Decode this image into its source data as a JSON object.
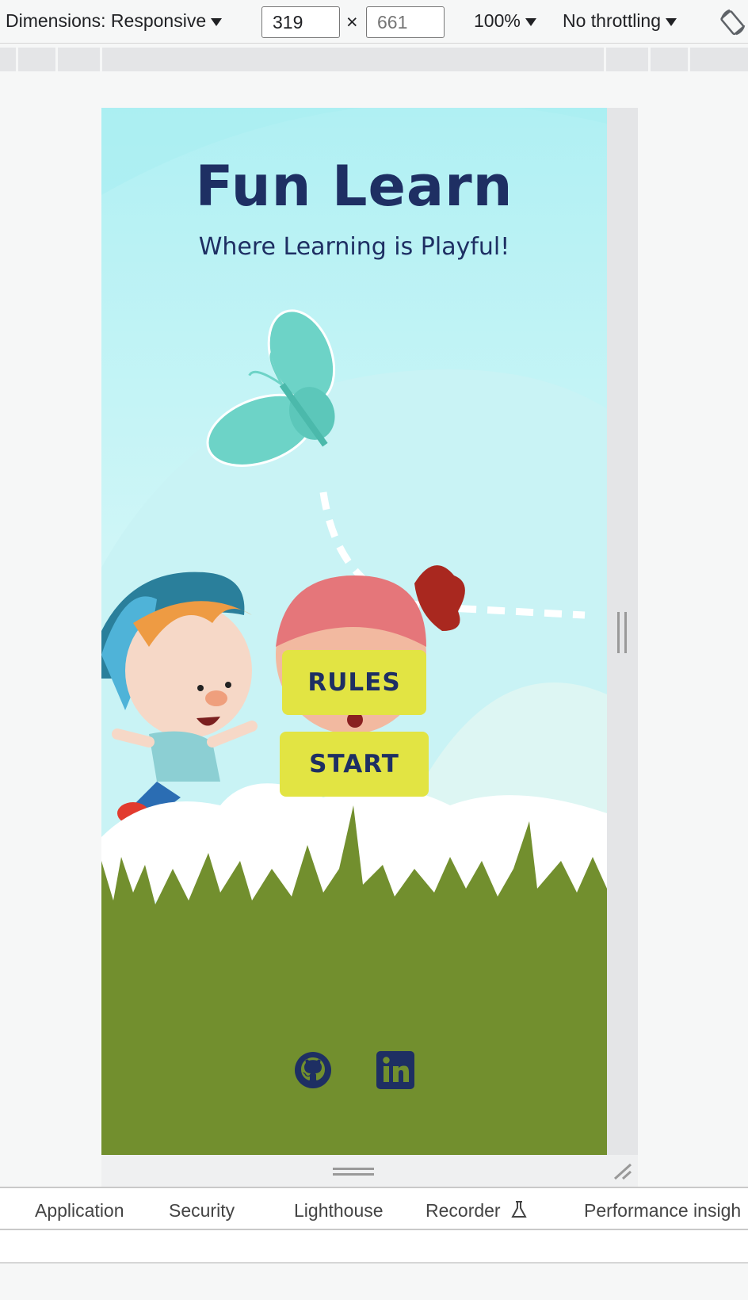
{
  "devtools_toolbar": {
    "dimensions_label": "Dimensions: Responsive",
    "width_value": "319",
    "times_symbol": "×",
    "height_placeholder": "661",
    "zoom_label": "100%",
    "throttling_label": "No throttling"
  },
  "page": {
    "title": "Fun Learn",
    "subtitle": "Where Learning is Playful!",
    "rules_button": "RULES",
    "start_button": "START",
    "social_icons": [
      "github-icon",
      "linkedin-icon"
    ]
  },
  "devtools_tabs": [
    "Application",
    "Security",
    "Lighthouse",
    "Recorder",
    "Performance insigh"
  ],
  "colors": {
    "title": "#1e2f63",
    "button_bg": "#e2e443",
    "sky": "#b5f1f4",
    "grass": "#728f2e",
    "butterfly": "#6dd3c7"
  }
}
